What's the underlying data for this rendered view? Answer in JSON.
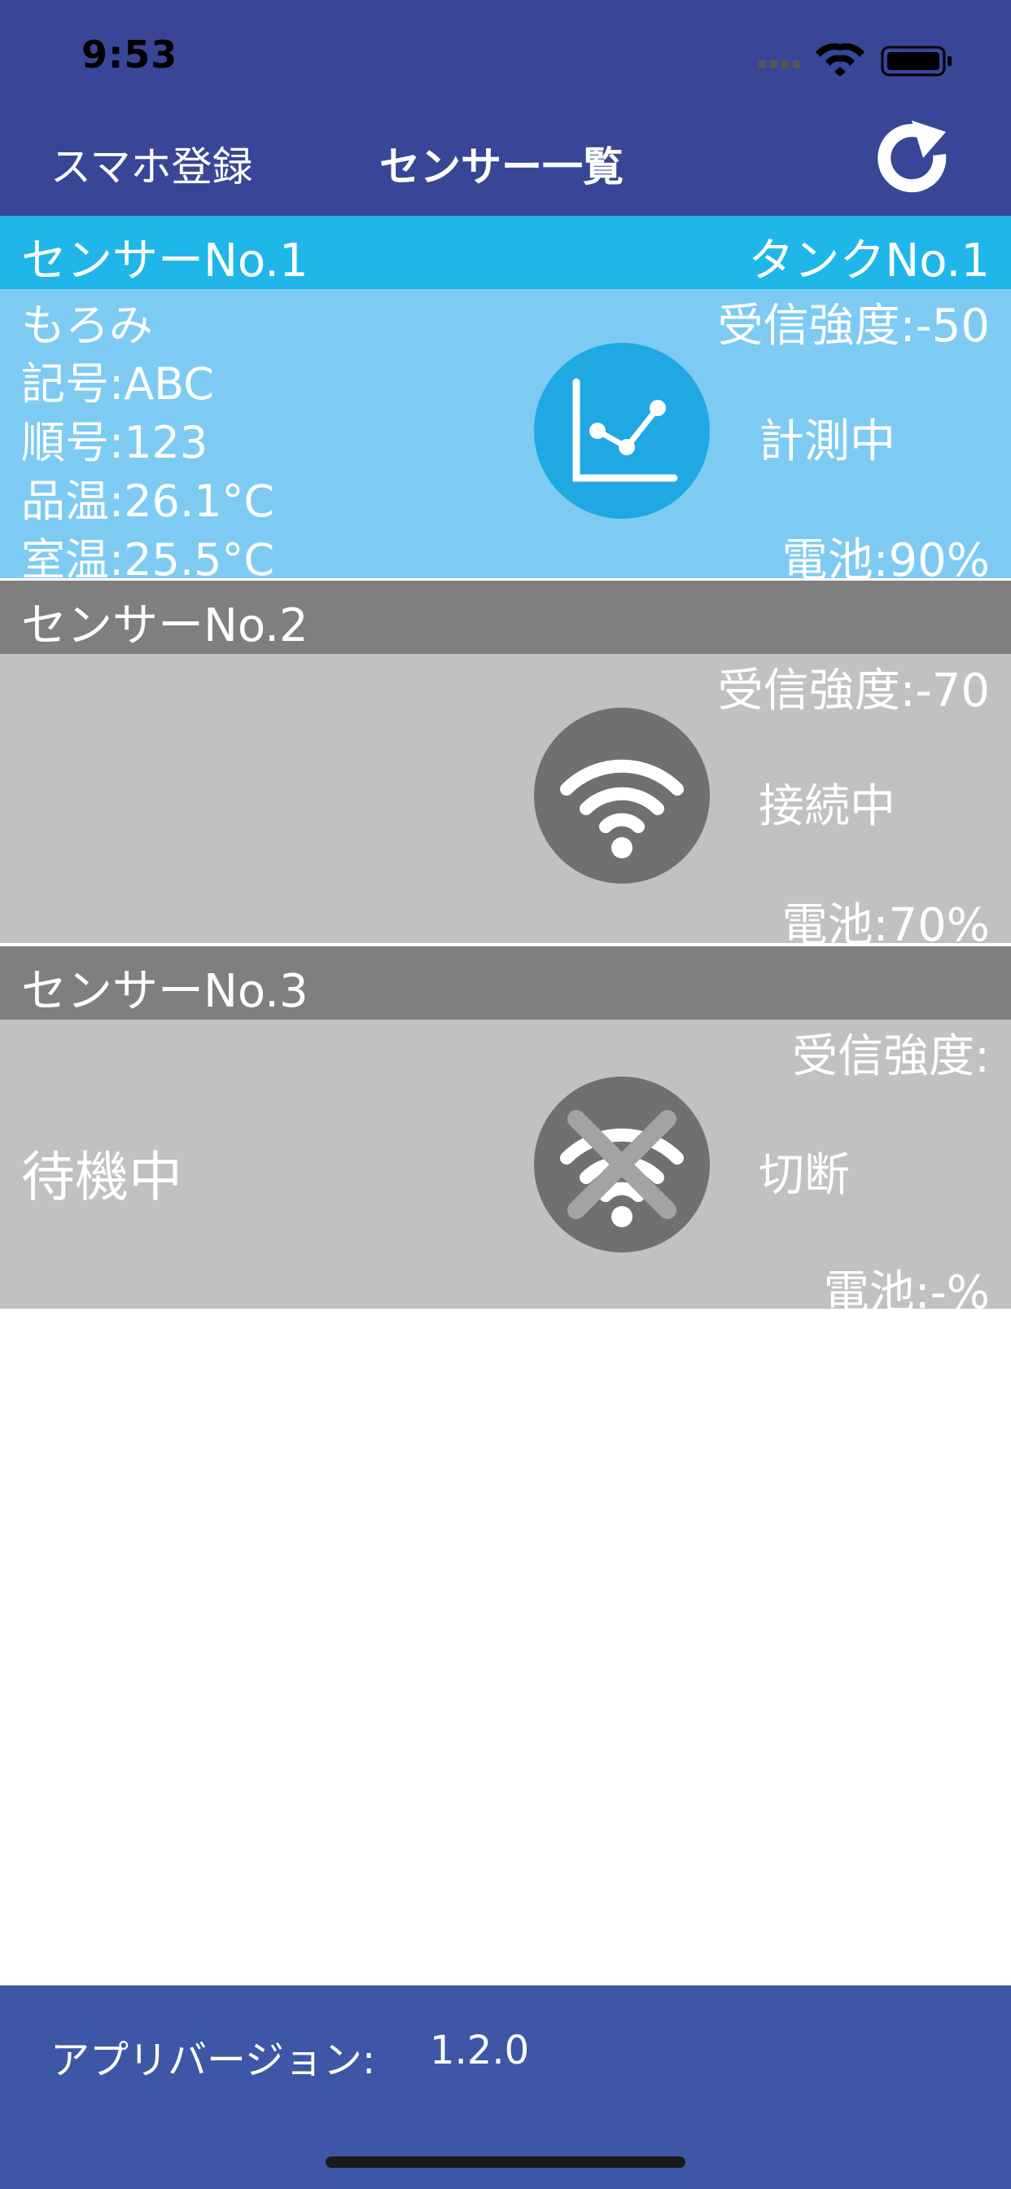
{
  "status_bar": {
    "time": "9:53"
  },
  "nav": {
    "register_label": "スマホ登録",
    "title": "センサー一覧",
    "refresh_icon": "refresh-icon"
  },
  "sensors": [
    {
      "name": "センサーNo.1",
      "tank": "タンクNo.1",
      "product": "もろみ",
      "symbol": "記号:ABC",
      "order": "順号:123",
      "product_temp": "品温:26.1°C",
      "room_temp": "室温:25.5°C",
      "signal": "受信強度:-50",
      "status": "計測中",
      "battery": "電池:90%",
      "icon": "chart-icon",
      "state_color": "#1fb7ea"
    },
    {
      "name": "センサーNo.2",
      "signal": "受信強度:-70",
      "status": "接続中",
      "battery": "電池:70%",
      "icon": "wifi-icon",
      "state_color": "#7f7f7f"
    },
    {
      "name": "センサーNo.3",
      "standby": "待機中",
      "signal": "受信強度:",
      "status": "切断",
      "battery": "電池:-%",
      "icon": "wifi-off-icon",
      "state_color": "#7f7f7f"
    }
  ],
  "footer": {
    "version_label": "アプリバージョン:",
    "version_value": "1.2.0"
  },
  "colors": {
    "nav_bg": "#394596",
    "footer_bg": "#3d57a6",
    "active_header": "#1fb7ea",
    "active_body": "#7dcbf2",
    "inactive_header": "#7f7f7f",
    "inactive_body": "#c0c1c1"
  }
}
